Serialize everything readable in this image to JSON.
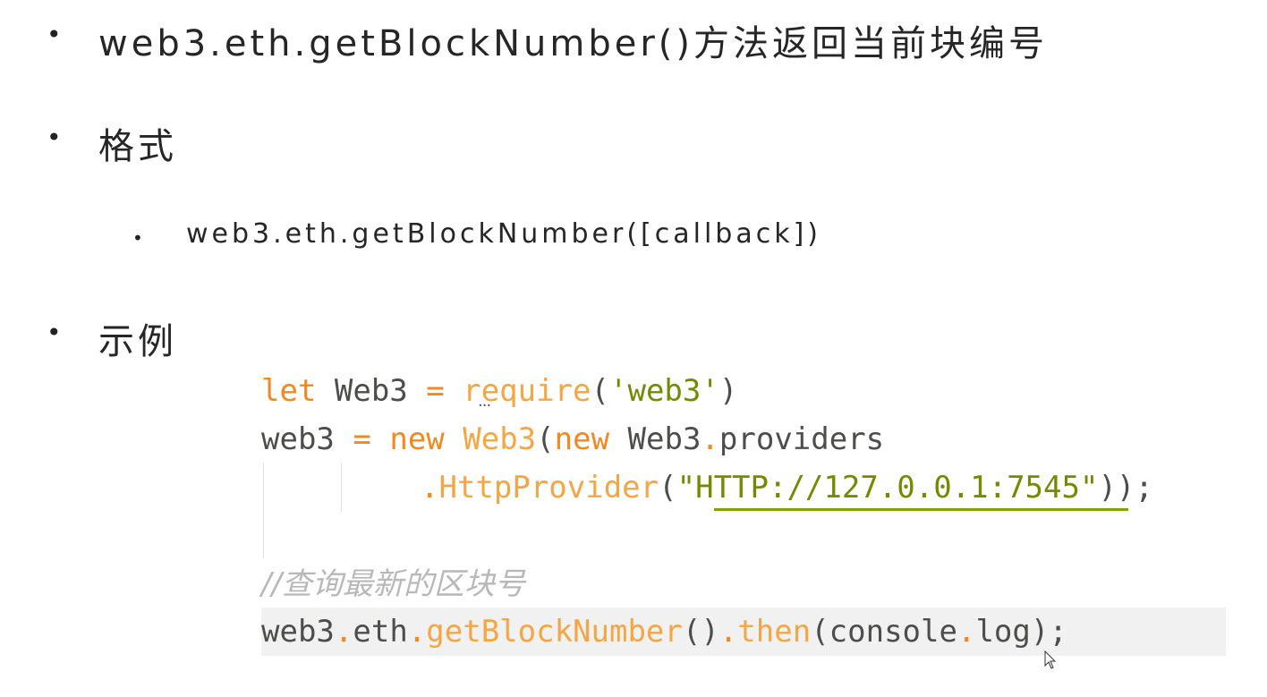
{
  "slide": {
    "bullet_glyph": "•",
    "item1": {
      "prefix": "web3.eth.getBlockNumber()",
      "suffix": "方法返回当前块编号"
    },
    "item2": {
      "label": "格式"
    },
    "item2_sub": {
      "text": "web3.eth.getBlockNumber([callback])"
    },
    "item3": {
      "label": "示例"
    }
  },
  "code": {
    "line1": {
      "kw": "let",
      "name": " Web3 ",
      "op": "=",
      "sp": " ",
      "fn_r": "r",
      "fn_rest": "equire",
      "open": "(",
      "str": "'web3'",
      "close": ")"
    },
    "line2": {
      "var": "web3",
      "sp1": " ",
      "op": "=",
      "sp2": " ",
      "kw1": "new",
      "sp3": " ",
      "cls": "Web3",
      "open": "(",
      "kw2": "new",
      "sp4": " ",
      "obj": "Web3",
      "dot": ".",
      "prop": "providers"
    },
    "line3": {
      "dot": ".",
      "fn": "HttpProvider",
      "open": "(",
      "q1": "\"",
      "url": "HTTP://127.0.0.1:7545",
      "q2": "\"",
      "close": "));"
    },
    "line4": {
      "comment": "//查询最新的区块号"
    },
    "line5": {
      "obj": "web3",
      "d1": ".",
      "eth": "eth",
      "d2": ".",
      "fn": "getBlockNumber",
      "paren": "()",
      "d3": ".",
      "then": "then",
      "open": "(",
      "console": "console",
      "d4": ".",
      "log": "log",
      "close": ");"
    }
  },
  "colors": {
    "keyword": "#f5871f",
    "function": "#f5a642",
    "string": "#718c00",
    "comment": "#b8b8b8",
    "text": "#4d4d4c",
    "highlight_line": "#f1f1f1"
  },
  "icons": {
    "cursor": "mouse-pointer-icon",
    "squiggle": "ellipsis-hint-icon"
  }
}
